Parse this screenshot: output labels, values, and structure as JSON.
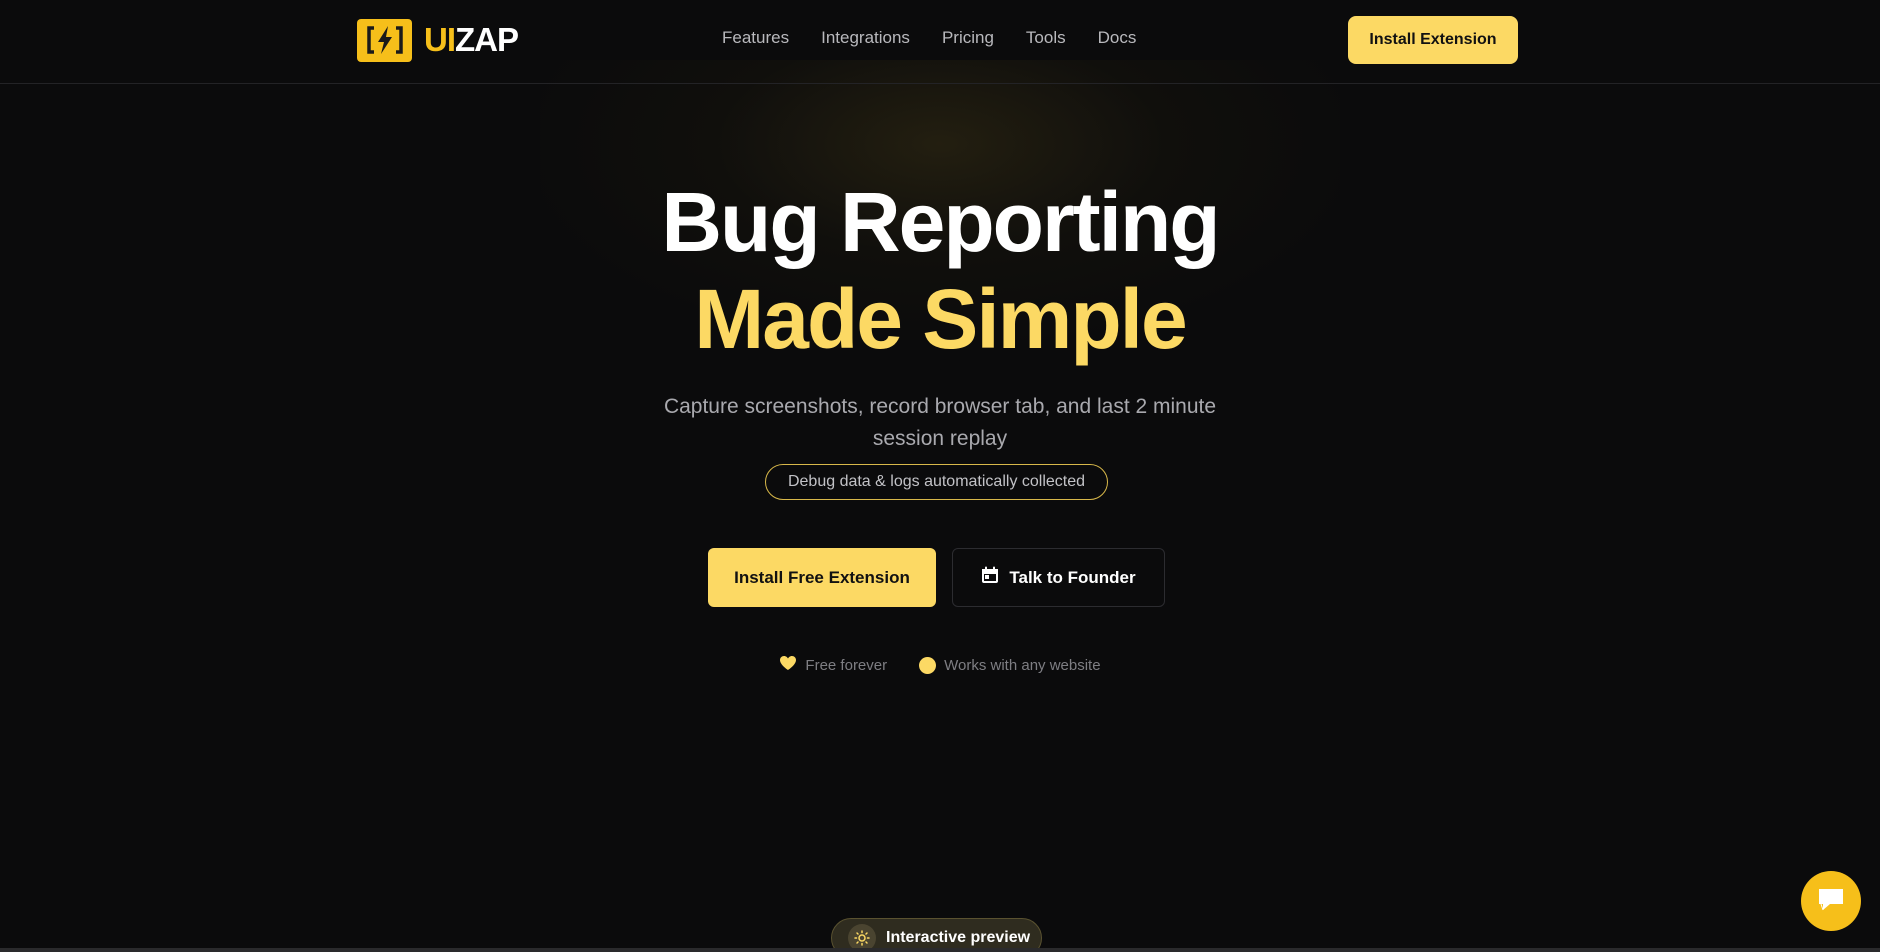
{
  "brand": {
    "logo_ui": "UI",
    "logo_zap": "ZAP",
    "accent": "#fcd964",
    "logo_color": "#f6bf1a"
  },
  "nav": {
    "items": [
      {
        "label": "Features"
      },
      {
        "label": "Integrations"
      },
      {
        "label": "Pricing"
      },
      {
        "label": "Tools"
      },
      {
        "label": "Docs"
      }
    ],
    "cta_label": "Install Extension"
  },
  "hero": {
    "title_line1": "Bug Reporting",
    "title_line2": "Made Simple",
    "subtitle": "Capture screenshots, record browser tab, and last 2 minute session replay",
    "pill": "Debug data & logs automatically collected",
    "primary_cta": "Install Free Extension",
    "secondary_cta": "Talk to Founder",
    "features": [
      {
        "icon": "heart-icon",
        "label": "Free forever"
      },
      {
        "icon": "dot-icon",
        "label": "Works with any website"
      }
    ]
  },
  "preview_badge": {
    "label": "Interactive preview",
    "icon": "sun-icon"
  },
  "chat": {
    "icon": "chat-icon"
  }
}
